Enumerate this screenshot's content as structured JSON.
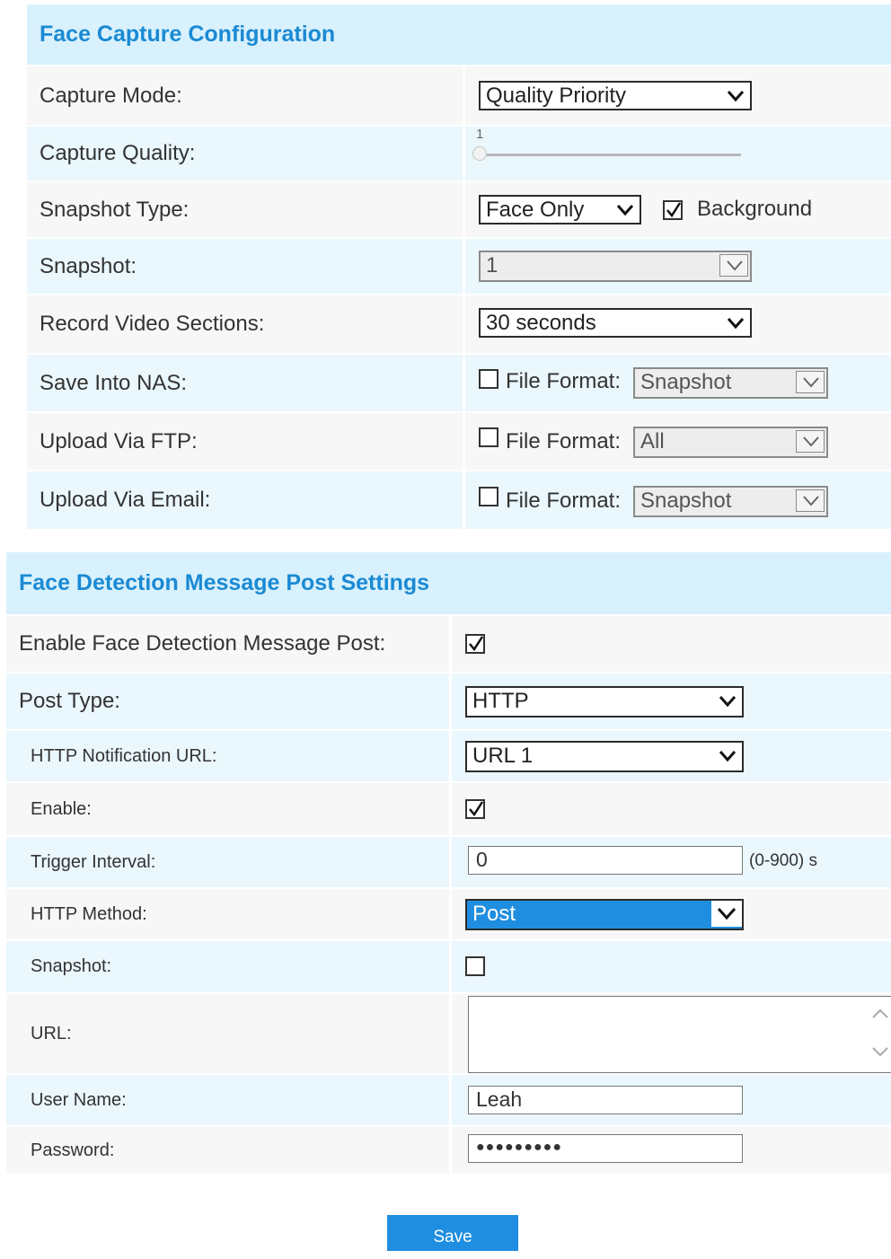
{
  "capture": {
    "title": "Face Capture Configuration",
    "capture_mode_label": "Capture Mode:",
    "capture_mode_value": "Quality Priority",
    "capture_quality_label": "Capture Quality:",
    "capture_quality_value": "1",
    "snapshot_type_label": "Snapshot Type:",
    "snapshot_type_value": "Face Only",
    "background_label": "Background",
    "background_checked": true,
    "snapshot_label": "Snapshot:",
    "snapshot_value": "1",
    "record_label": "Record Video Sections:",
    "record_value": "30 seconds",
    "nas_label": "Save Into NAS:",
    "ftp_label": "Upload Via FTP:",
    "email_label": "Upload Via Email:",
    "file_format_label": "File Format:",
    "nas_format": "Snapshot",
    "ftp_format": "All",
    "email_format": "Snapshot"
  },
  "post": {
    "title": "Face Detection Message Post Settings",
    "enable_post_label": "Enable Face Detection Message Post:",
    "post_type_label": "Post Type:",
    "post_type_value": "HTTP",
    "http_url_label": "HTTP Notification URL:",
    "http_url_value": "URL 1",
    "enable_label": "Enable:",
    "trigger_label": "Trigger Interval:",
    "trigger_value": "0",
    "trigger_range": "(0-900) s",
    "method_label": "HTTP Method:",
    "method_value": "Post",
    "snapshot_label": "Snapshot:",
    "url_label": "URL:",
    "url_value": "",
    "user_label": "User Name:",
    "user_value": "Leah",
    "password_label": "Password:",
    "password_value": "●●●●●●●●●"
  },
  "save_label": "Save",
  "colors": {
    "accent": "#1f8ee0",
    "header_bg": "#d9f1fc",
    "header_text": "#1a8ad4"
  }
}
